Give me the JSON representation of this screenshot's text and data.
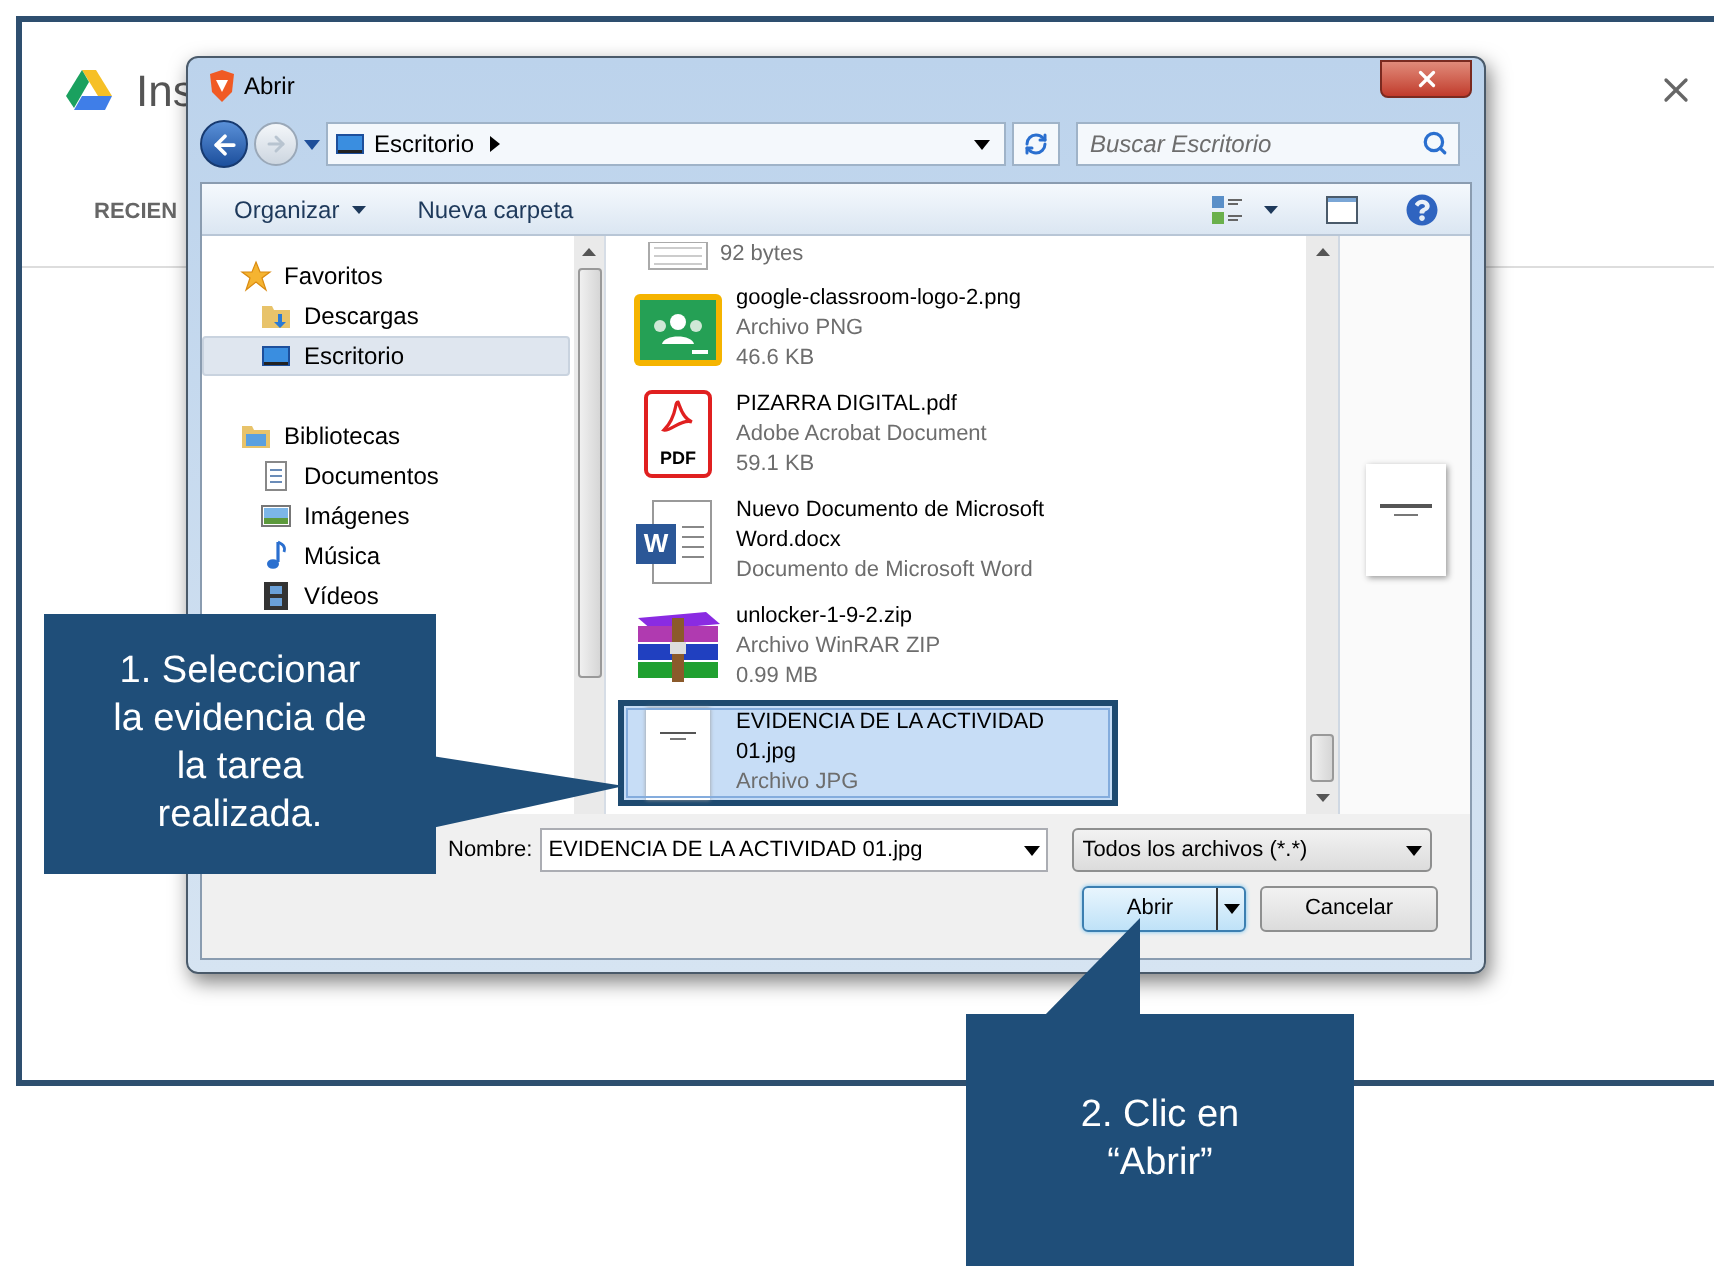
{
  "drive_dialog": {
    "title": "Ins",
    "tab": "RECIEN"
  },
  "file_dialog": {
    "title": "Abrir",
    "address": "Escritorio",
    "search_placeholder": "Buscar Escritorio",
    "toolbar": [
      "Organizar",
      "Nueva carpeta"
    ],
    "nav": [
      {
        "label": "Favoritos",
        "kind": "star",
        "selected": false,
        "children": [
          {
            "label": "Descargas",
            "kind": "downloads",
            "selected": false
          },
          {
            "label": "Escritorio",
            "kind": "desktop",
            "selected": true
          }
        ]
      },
      {
        "label": "Bibliotecas",
        "kind": "library",
        "selected": false,
        "children": [
          {
            "label": "Documentos",
            "kind": "documents",
            "selected": false
          },
          {
            "label": "Imágenes",
            "kind": "pictures",
            "selected": false
          },
          {
            "label": "Música",
            "kind": "music",
            "selected": false
          },
          {
            "label": "Vídeos",
            "kind": "videos",
            "selected": false
          }
        ]
      }
    ],
    "files": [
      {
        "kind": "text",
        "size": "92 bytes",
        "selected": false
      },
      {
        "kind": "classroom",
        "name": "google-classroom-logo-2.png",
        "type": "Archivo PNG",
        "size": "46.6 KB",
        "selected": false
      },
      {
        "kind": "pdf",
        "badge": "PDF",
        "name": "PIZARRA DIGITAL.pdf",
        "type": "Adobe Acrobat Document",
        "size": "59.1 KB",
        "selected": false
      },
      {
        "kind": "word",
        "badge": "W",
        "name": "Nuevo Documento de Microsoft Word.docx",
        "type": "Documento de Microsoft Word",
        "selected": false
      },
      {
        "kind": "winrar",
        "name": "unlocker-1-9-2.zip",
        "type": "Archivo WinRAR ZIP",
        "size": "0.99 MB",
        "selected": false
      },
      {
        "kind": "jpg",
        "name": "EVIDENCIA DE LA ACTIVIDAD 01.jpg",
        "type": "Archivo JPG",
        "selected": true
      }
    ],
    "filename_label": "Nombre:",
    "filename": "EVIDENCIA DE LA ACTIVIDAD 01.jpg",
    "filter": "Todos los archivos (*.*)",
    "buttons": [
      {
        "label": "Abrir",
        "kind": "split"
      },
      {
        "label": "Cancelar",
        "kind": "plain"
      }
    ]
  },
  "callouts": [
    {
      "text": "1. Seleccionar la evidencia de la tarea realizada.",
      "kind": "left"
    },
    {
      "text": "2. Clic en “Abrir”",
      "kind": "up"
    }
  ]
}
